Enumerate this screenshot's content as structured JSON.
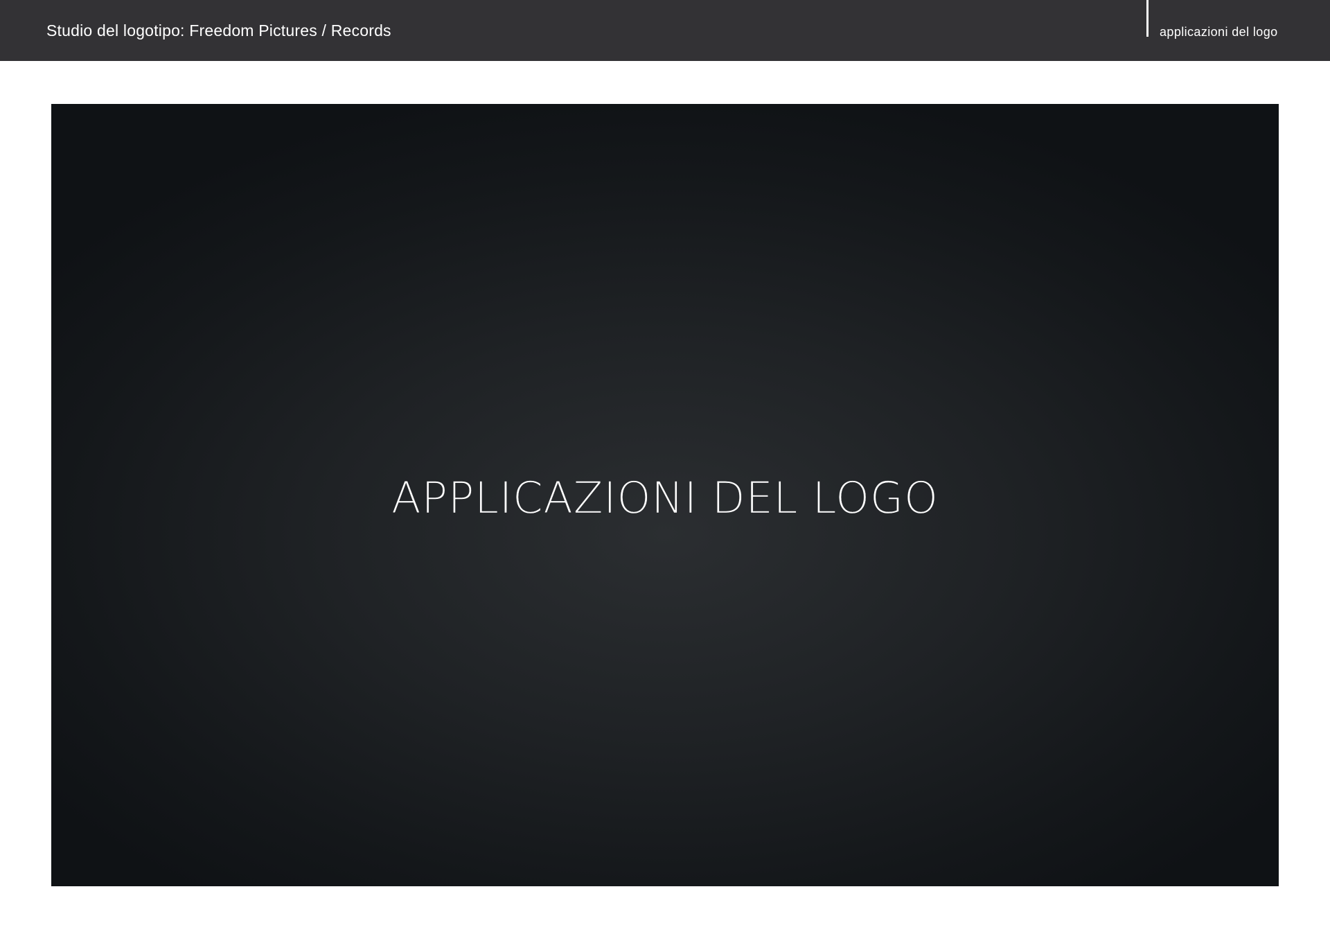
{
  "header": {
    "title": "Studio del logotipo: Freedom Pictures / Records",
    "section": "applicazioni del logo"
  },
  "slide": {
    "title": "APPLICAZIONI DEL LOGO"
  },
  "colors": {
    "header_background": "#333235",
    "slide_background": "#1f2225",
    "text": "#ffffff"
  }
}
